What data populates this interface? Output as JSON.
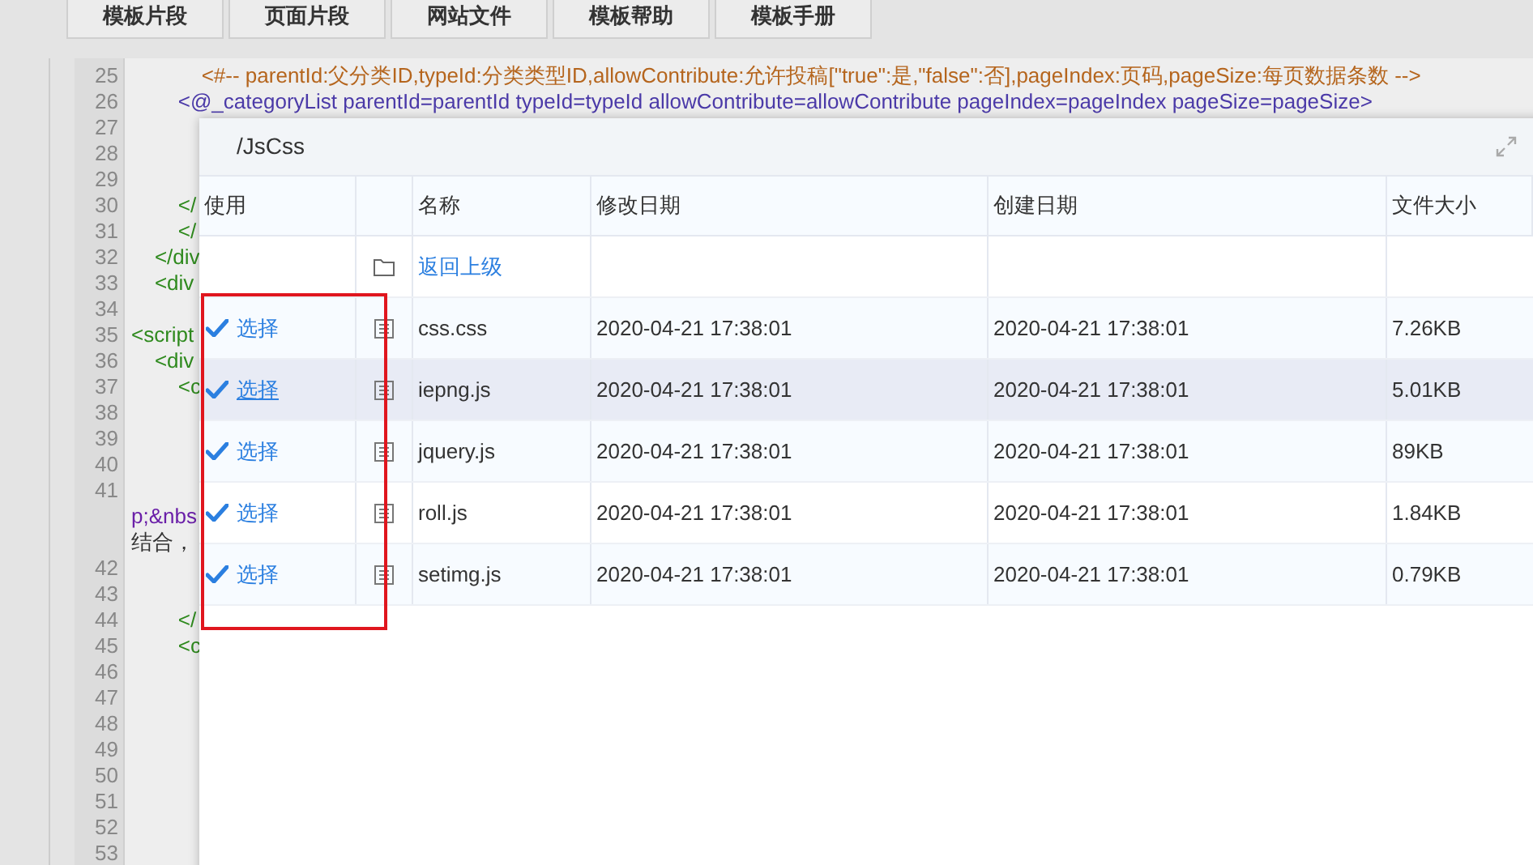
{
  "toolbar": {
    "buttons": [
      "模板片段",
      "页面片段",
      "网站文件",
      "模板帮助",
      "模板手册"
    ]
  },
  "editor": {
    "lines": [
      {
        "number": "25",
        "kind": "comment",
        "text": "            <#-- parentId:父分类ID,typeId:分类类型ID,allowContribute:允许投稿[\"true\":是,\"false\":否],pageIndex:页码,pageSize:每页数据条数 -->"
      },
      {
        "number": "26",
        "kind": "directive",
        "text": "        <@_categoryList parentId=parentId typeId=typeId allowContribute=allowContribute pageIndex=pageIndex pageSize=pageSize>"
      },
      {
        "number": "27"
      },
      {
        "number": "28"
      },
      {
        "number": "29"
      },
      {
        "number": "30",
        "kind": "tag",
        "text": "        </"
      },
      {
        "number": "31",
        "kind": "tag",
        "text": "        </"
      },
      {
        "number": "32",
        "kind": "tag",
        "text": "    </div"
      },
      {
        "number": "33",
        "kind": "tag",
        "text": "    <div"
      },
      {
        "number": "34"
      },
      {
        "number": "35",
        "kind": "tag",
        "text": "<script"
      },
      {
        "number": "36",
        "kind": "tag",
        "text": "    <div"
      },
      {
        "number": "37",
        "kind": "tag",
        "text": "        <c"
      },
      {
        "number": "38"
      },
      {
        "number": "39"
      },
      {
        "number": "40"
      },
      {
        "number": "41"
      },
      {
        "kind": "entity",
        "text": "p;&nbs"
      },
      {
        "kind": "text",
        "text": "结合，"
      },
      {
        "number": "42"
      },
      {
        "number": "43"
      },
      {
        "number": "44",
        "kind": "tag",
        "text": "        </"
      },
      {
        "number": "45",
        "kind": "tag",
        "text": "        <c"
      },
      {
        "number": "46"
      },
      {
        "number": "47"
      },
      {
        "number": "48"
      },
      {
        "number": "49"
      },
      {
        "number": "50"
      },
      {
        "number": "51"
      },
      {
        "number": "52"
      },
      {
        "number": "53"
      }
    ]
  },
  "dialog": {
    "title": "/JsCss",
    "table": {
      "columns": [
        "使用",
        "",
        "名称",
        "修改日期",
        "创建日期",
        "文件大小"
      ],
      "rows": [
        {
          "kind": "parent",
          "name": "返回上级",
          "selected": false
        },
        {
          "kind": "file",
          "use": "选择",
          "name": "css.css",
          "modified": "2020-04-21 17:38:01",
          "created": "2020-04-21 17:38:01",
          "size": "7.26KB",
          "selected": false
        },
        {
          "kind": "file",
          "use": "选择",
          "name": "iepng.js",
          "modified": "2020-04-21 17:38:01",
          "created": "2020-04-21 17:38:01",
          "size": "5.01KB",
          "selected": true
        },
        {
          "kind": "file",
          "use": "选择",
          "name": "jquery.js",
          "modified": "2020-04-21 17:38:01",
          "created": "2020-04-21 17:38:01",
          "size": "89KB",
          "selected": false
        },
        {
          "kind": "file",
          "use": "选择",
          "name": "roll.js",
          "modified": "2020-04-21 17:38:01",
          "created": "2020-04-21 17:38:01",
          "size": "1.84KB",
          "selected": false
        },
        {
          "kind": "file",
          "use": "选择",
          "name": "setimg.js",
          "modified": "2020-04-21 17:38:01",
          "created": "2020-04-21 17:38:01",
          "size": "0.79KB",
          "selected": false
        }
      ]
    }
  }
}
